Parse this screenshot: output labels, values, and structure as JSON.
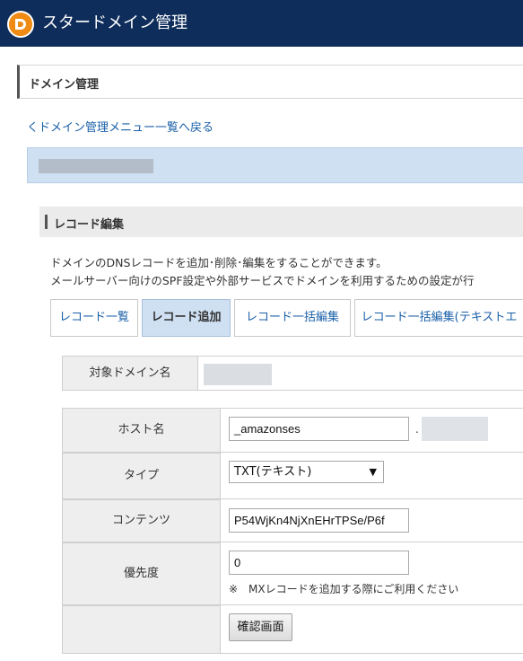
{
  "header": {
    "title": "スタードメイン管理",
    "logo_icon": "star-domain-logo"
  },
  "section": {
    "title": "ドメイン管理"
  },
  "back_link": "くドメイン管理メニュー一覧へ戻る",
  "record_edit": {
    "title": "レコード編集",
    "desc_line1": "ドメインのDNSレコードを追加･削除･編集をすることができます。",
    "desc_line2": "メールサーバー向けのSPF設定や外部サービスでドメインを利用するための設定が行"
  },
  "tabs": [
    {
      "label": "レコード一覧",
      "active": false
    },
    {
      "label": "レコード追加",
      "active": true
    },
    {
      "label": "レコード一括編集",
      "active": false
    },
    {
      "label": "レコード一括編集(テキストエ",
      "active": false
    }
  ],
  "target": {
    "label": "対象ドメイン名"
  },
  "form": {
    "host_label": "ホスト名",
    "host_value": "_amazonses",
    "host_suffix_dot": ".",
    "type_label": "タイプ",
    "type_value": "TXT(テキスト)",
    "content_label": "コンテンツ",
    "content_value": "P54WjKn4NjXnEHrTPSe/P6f",
    "priority_label": "優先度",
    "priority_value": "0",
    "priority_note": "※　MXレコードを追加する際にご利用ください",
    "confirm_button": "確認画面"
  },
  "colors": {
    "header_bg": "#0e2d5a",
    "logo": "#ef8a12",
    "link": "#1a5fa8",
    "active_tab": "#cfe0f3"
  }
}
